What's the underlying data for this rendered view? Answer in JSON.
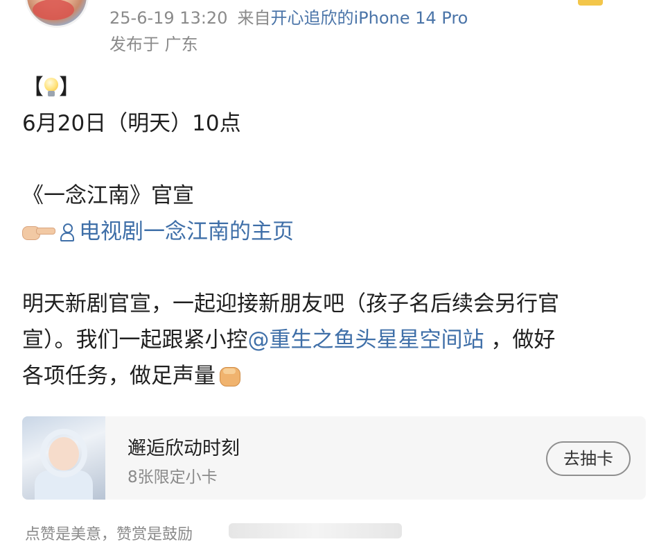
{
  "header": {
    "timestamp": "25-6-19 13:20",
    "source_prefix": "来自",
    "device_owner": "开心追欣的",
    "device_model": "iPhone 14 Pro",
    "location": "发布于 广东"
  },
  "post": {
    "bracket_open": "【",
    "bracket_close": "】",
    "date_line": "6月20日（明天）10点",
    "title_line": "《一念江南》官宣",
    "link_text": "电视剧一念江南的主页",
    "para1_line1": "明天新剧官宣，一起迎接新朋友吧（孩子名后续会另行官",
    "para1_line2_start": "宣）。我们一起跟紧小控",
    "mention": "@重生之鱼头星星空间站",
    "para1_line2_end": " ，做好",
    "para1_line3": "各项任务，做足声量"
  },
  "card": {
    "title": "邂逅欣动时刻",
    "subtitle": "8张限定小卡",
    "button_label": "去抽卡"
  },
  "footer": {
    "note": "点赞是美意，赞赏是鼓励"
  },
  "colors": {
    "link": "#3f6fa8",
    "meta": "#8a8a8a",
    "text": "#1f1f1f",
    "card_bg": "#f6f6f6"
  },
  "icons": [
    "lightbulb-icon",
    "pointing-hand-icon",
    "user-icon",
    "fist-icon"
  ]
}
